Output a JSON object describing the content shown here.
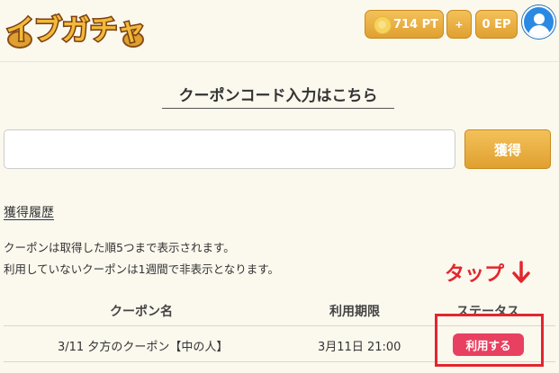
{
  "header": {
    "logo_text": "イブガチャ",
    "points": "714 PT",
    "plus": "+",
    "ep": "0 EP",
    "icons": {
      "coin": "coin-icon",
      "avatar": "user-avatar-icon"
    }
  },
  "coupon": {
    "title": "クーポンコード入力はこちら",
    "input_value": "",
    "input_placeholder": "",
    "submit_label": "獲得"
  },
  "history": {
    "heading": "獲得履歴",
    "note1": "クーポンは取得した順5つまで表示されます。",
    "note2": "利用していないクーポンは1週間で非表示となります。",
    "annotation": "タップ",
    "columns": [
      "クーポン名",
      "利用期限",
      "ステータス"
    ],
    "rows": [
      {
        "name": "3/11 夕方のクーポン【中の人】",
        "period": "3月11日 21:00",
        "action": "利用する"
      }
    ]
  },
  "colors": {
    "background": "#fbf8ee",
    "gold": "#e0a030",
    "use_button": "#e84060",
    "annotation_red": "#e2262e",
    "avatar_blue": "#2a89e3"
  }
}
